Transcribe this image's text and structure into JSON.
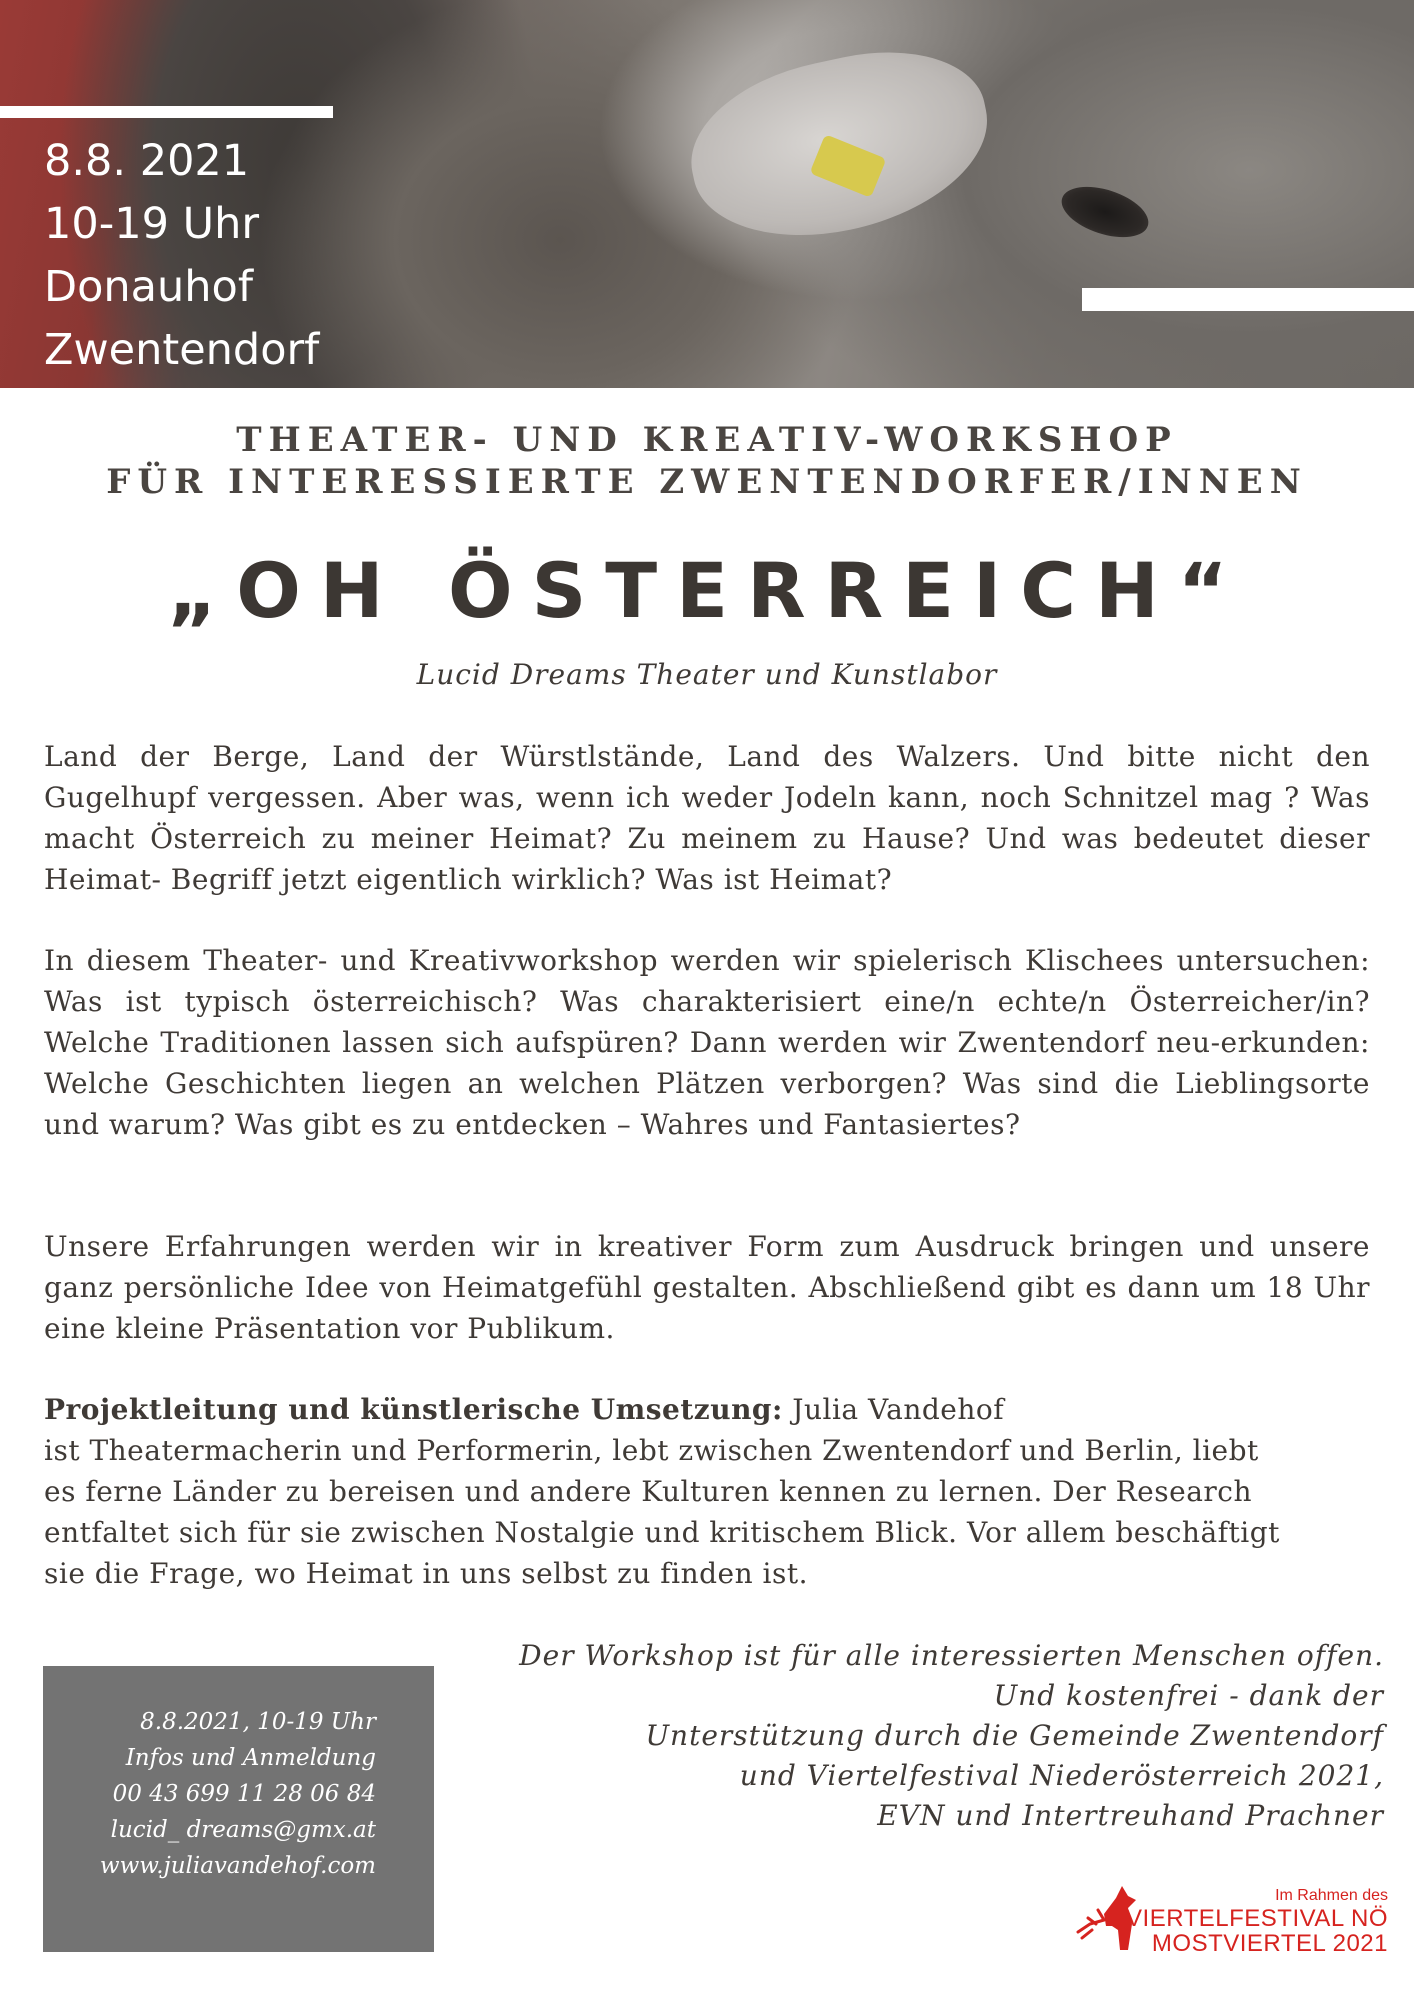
{
  "hero": {
    "date": "8.8. 2021",
    "time": "10-19 Uhr",
    "place": "Donauhof",
    "town": "Zwentendorf"
  },
  "headings": {
    "line1": "THEATER- UND KREATIV-WORKSHOP",
    "line2": "FÜR INTERESSIERTE ZWENTENDORFER/INNEN",
    "title": "„OH ÖSTERREICH“",
    "credit": "Lucid Dreams Theater und Kunstlabor"
  },
  "body": {
    "p1": "Land der Berge, Land der Würstlstände, Land des Walzers. Und bitte nicht den Gugelhupf vergessen. Aber was, wenn ich weder Jodeln kann, noch Schnitzel mag ? Was macht Österreich zu meiner Heimat? Zu meinem zu Hause? Und was bedeutet dieser Heimat- Begriff jetzt eigentlich wirklich? Was ist Heimat?",
    "p2": "In diesem Theater- und Kreativworkshop werden wir spielerisch Klischees untersuchen: Was ist typisch österreichisch? Was charakterisiert eine/n echte/n Österreicher/in? Welche Traditionen lassen sich aufspüren? Dann werden wir Zwentendorf neu-erkunden: Welche Geschichten liegen an welchen Plätzen verborgen? Was sind die Lieblingsorte und warum? Was gibt es zu entdecken – Wahres und Fantasiertes?",
    "p3": "Unsere Erfahrungen werden wir in kreativer Form zum Ausdruck bringen und unsere ganz persönliche Idee von Heimatgefühl gestalten. Abschließend gibt es dann um 18 Uhr eine kleine Präsentation vor Publikum.",
    "lead_label": "Projektleitung und künstlerische Umsetzung",
    "lead_colon": ":",
    "lead_name": " Julia Vandehof",
    "bio_lines": [
      "ist Theatermacherin und Performerin, lebt zwischen Zwentendorf und Berlin, liebt",
      "es ferne Länder zu bereisen und andere Kulturen kennen zu lernen. Der Research",
      "entfaltet sich für sie zwischen Nostalgie und kritischem Blick. Vor allem beschäftigt",
      "sie die Frage, wo Heimat in uns selbst zu finden ist."
    ]
  },
  "info_box": {
    "line1": "8.8.2021, 10-19 Uhr",
    "line2": "Infos und Anmeldung",
    "phone": "00 43 699 11 28 06 84",
    "email": "lucid_ dreams@gmx.at",
    "web": "www.juliavandehof.com"
  },
  "note": {
    "line1": "Der Workshop ist für alle interessierten Menschen offen.",
    "line2": "Und kostenfrei - dank der",
    "line3": "Unterstützung durch die Gemeinde Zwentendorf",
    "line4": "und Viertelfestival Niederösterreich 2021,",
    "line5": "EVN  und Intertreuhand Prachner"
  },
  "logo": {
    "line1": "Im Rahmen des",
    "line2": "VIERTELFESTIVAL NÖ",
    "line3": "MOSTVIERTEL 2021",
    "color": "#d6231f",
    "icon": "deer-icon"
  }
}
